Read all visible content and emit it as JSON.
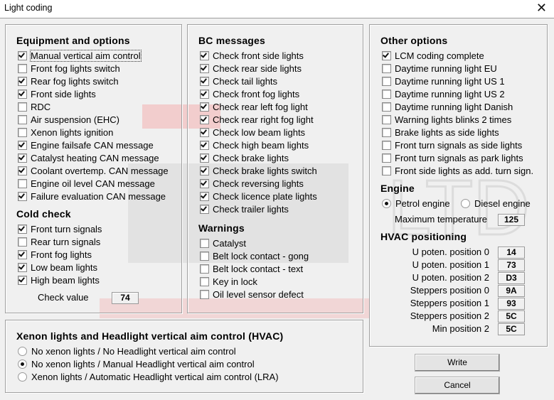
{
  "window": {
    "title": "Light coding",
    "close_icon": "close-icon"
  },
  "equipment": {
    "title": "Equipment and options",
    "items": [
      {
        "label": "Manual vertical aim control",
        "checked": true
      },
      {
        "label": "Front fog lights switch",
        "checked": false
      },
      {
        "label": "Rear fog lights switch",
        "checked": true
      },
      {
        "label": "Front side lights",
        "checked": true
      },
      {
        "label": "RDC",
        "checked": false
      },
      {
        "label": "Air suspension (EHC)",
        "checked": false
      },
      {
        "label": "Xenon lights ignition",
        "checked": false
      },
      {
        "label": "Engine failsafe CAN message",
        "checked": true
      },
      {
        "label": "Catalyst heating CAN message",
        "checked": true
      },
      {
        "label": "Coolant overtemp. CAN message",
        "checked": true
      },
      {
        "label": "Engine oil level CAN message",
        "checked": false
      },
      {
        "label": "Failure evaluation CAN message",
        "checked": true
      }
    ]
  },
  "cold_check": {
    "title": "Cold check",
    "items": [
      {
        "label": "Front turn signals",
        "checked": true
      },
      {
        "label": "Rear turn signals",
        "checked": false
      },
      {
        "label": "Front fog lights",
        "checked": true
      },
      {
        "label": "Low beam lights",
        "checked": true
      },
      {
        "label": "High beam lights",
        "checked": true
      }
    ],
    "check_value_label": "Check value",
    "check_value": "74"
  },
  "bc_messages": {
    "title": "BC messages",
    "items": [
      {
        "label": "Check front side lights",
        "checked": true
      },
      {
        "label": "Check rear side lights",
        "checked": true
      },
      {
        "label": "Check tail lights",
        "checked": true
      },
      {
        "label": "Check front fog lights",
        "checked": true
      },
      {
        "label": "Check rear left fog light",
        "checked": true
      },
      {
        "label": "Check rear right fog light",
        "checked": true
      },
      {
        "label": "Check low beam lights",
        "checked": true
      },
      {
        "label": "Check high beam lights",
        "checked": true
      },
      {
        "label": "Check brake lights",
        "checked": true
      },
      {
        "label": "Check brake lights switch",
        "checked": true
      },
      {
        "label": "Check reversing lights",
        "checked": true
      },
      {
        "label": "Check licence plate lights",
        "checked": true
      },
      {
        "label": "Check trailer lights",
        "checked": true
      }
    ]
  },
  "warnings": {
    "title": "Warnings",
    "items": [
      {
        "label": "Catalyst",
        "checked": false
      },
      {
        "label": "Belt lock contact - gong",
        "checked": false
      },
      {
        "label": "Belt lock contact - text",
        "checked": false
      },
      {
        "label": "Key in lock",
        "checked": false
      },
      {
        "label": "Oil level sensor defect",
        "checked": false
      }
    ]
  },
  "other_options": {
    "title": "Other options",
    "items": [
      {
        "label": "LCM coding complete",
        "checked": true
      },
      {
        "label": "Daytime running light EU",
        "checked": false
      },
      {
        "label": "Daytime running light US 1",
        "checked": false
      },
      {
        "label": "Daytime running light US 2",
        "checked": false
      },
      {
        "label": "Daytime running light Danish",
        "checked": false
      },
      {
        "label": "Warning lights blinks 2 times",
        "checked": false
      },
      {
        "label": "Brake lights as side lights",
        "checked": false
      },
      {
        "label": "Front turn signals as side lights",
        "checked": false
      },
      {
        "label": "Front turn signals as park lights",
        "checked": false
      },
      {
        "label": "Front side lights as add. turn sign.",
        "checked": false
      }
    ]
  },
  "engine": {
    "title": "Engine",
    "options": [
      {
        "label": "Petrol engine",
        "selected": true
      },
      {
        "label": "Diesel engine",
        "selected": false
      }
    ],
    "max_temp_label": "Maximum temperature",
    "max_temp": "125"
  },
  "hvac_positioning": {
    "title": "HVAC positioning",
    "rows": [
      {
        "label": "U poten. position 0",
        "value": "14"
      },
      {
        "label": "U poten. position 1",
        "value": "73"
      },
      {
        "label": "U poten. position 2",
        "value": "D3"
      },
      {
        "label": "Steppers position 0",
        "value": "9A"
      },
      {
        "label": "Steppers position 1",
        "value": "93"
      },
      {
        "label": "Steppers position 2",
        "value": "5C"
      },
      {
        "label": "Min position 2",
        "value": "5C"
      }
    ]
  },
  "xenon": {
    "title": "Xenon lights and Headlight vertical aim control (HVAC)",
    "options": [
      {
        "label": "No xenon lights / No Headlight vertical aim control",
        "selected": false
      },
      {
        "label": "No xenon lights / Manual Headlight vertical aim control",
        "selected": true
      },
      {
        "label": "Xenon lights / Automatic Headlight vertical aim control (LRA)",
        "selected": false
      }
    ]
  },
  "buttons": {
    "write": "Write",
    "cancel": "Cancel"
  },
  "watermark": {
    "text": "MOTO LTD",
    "accent": "#e8a0a0",
    "gray": "#d8d8d8"
  }
}
